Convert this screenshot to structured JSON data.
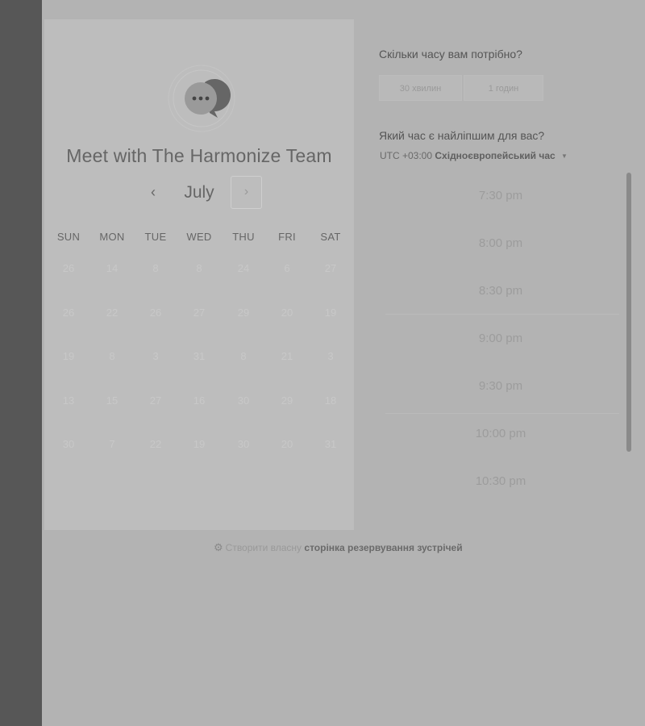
{
  "calendar": {
    "title": "Meet with The Harmonize Team",
    "month": "July",
    "prev_icon": "‹",
    "next_icon": "›",
    "weekdays": [
      "SUN",
      "MON",
      "TUE",
      "WED",
      "THU",
      "FRI",
      "SAT"
    ],
    "weeks": [
      [
        "26",
        "14",
        "8",
        "8",
        "24",
        "6",
        "27"
      ],
      [
        "26",
        "22",
        "26",
        "27",
        "29",
        "20",
        "19"
      ],
      [
        "19",
        "8",
        "3",
        "31",
        "8",
        "21",
        "3"
      ],
      [
        "13",
        "15",
        "27",
        "16",
        "30",
        "29",
        "18"
      ],
      [
        "30",
        "7",
        "22",
        "19",
        "30",
        "20",
        "31"
      ]
    ]
  },
  "duration": {
    "question": "Скільки часу вам потрібно?",
    "options": [
      "30 хвилин",
      "1 годин"
    ]
  },
  "timeslots": {
    "question": "Який час є найліпшим для вас?",
    "timezone_offset": "UTC +03:00",
    "timezone_name": "Східноєвропейський час",
    "times": [
      "7:30 pm",
      "8:00 pm",
      "8:30 pm",
      "9:00 pm",
      "9:30 pm",
      "10:00 pm",
      "10:30 pm"
    ]
  },
  "footer": {
    "icon": "sprocket-icon",
    "prefix": "Створити власну",
    "link": "сторінка резервування зустрічей"
  },
  "colors": {
    "background": "#b3b3b3",
    "left_strip": "#575757",
    "card": "#bdbdbd"
  }
}
